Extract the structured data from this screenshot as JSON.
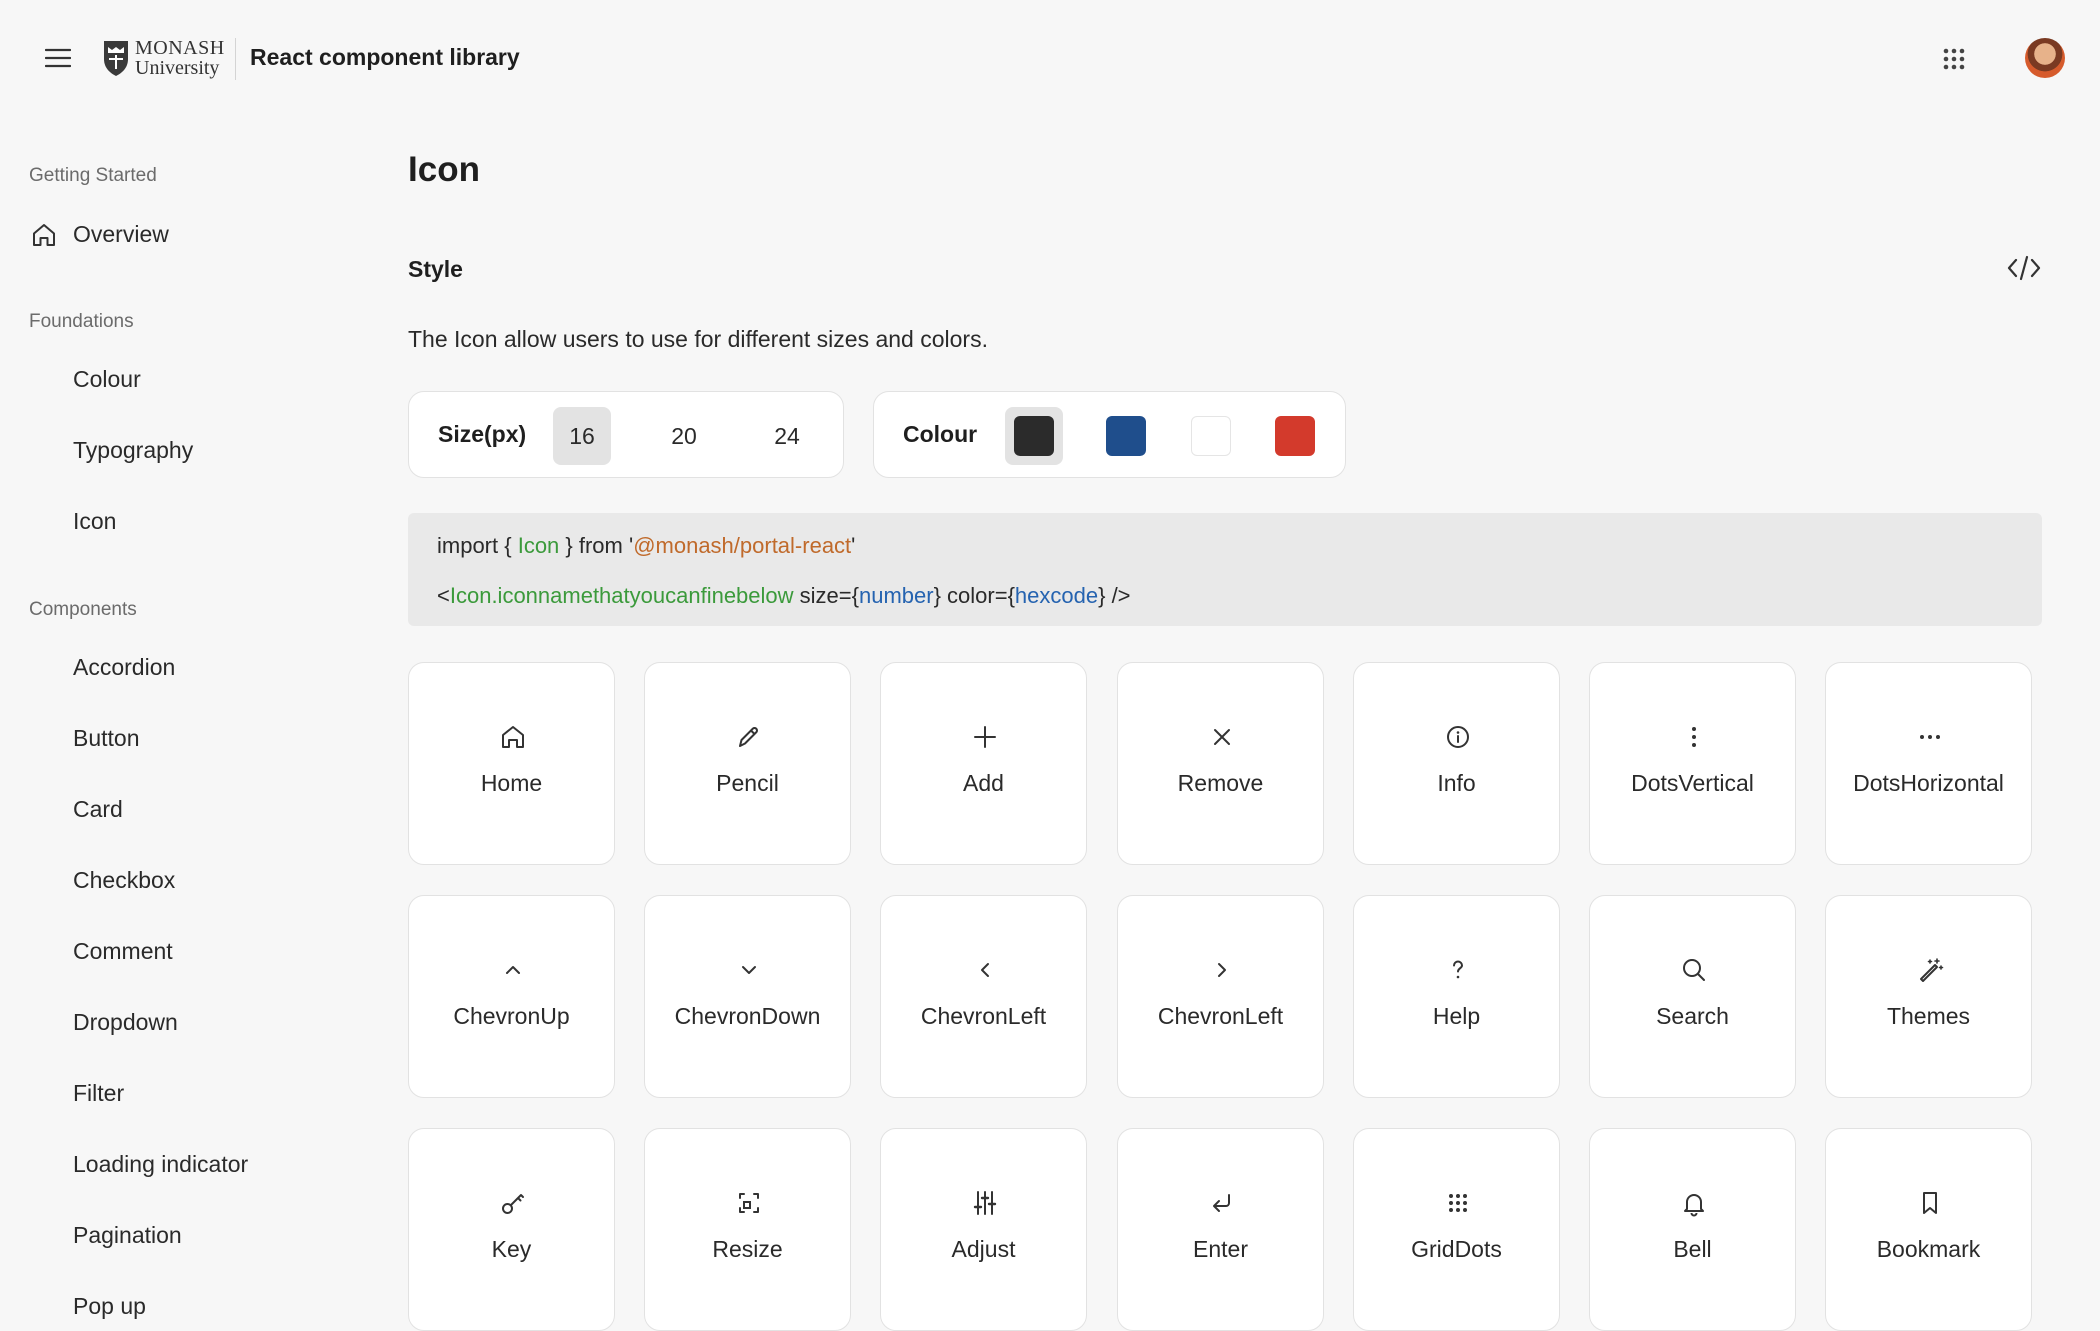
{
  "header": {
    "logo_line1": "MONASH",
    "logo_line2": "University",
    "app_title": "React component library",
    "icons": {
      "menu": "hamburger-icon",
      "apps": "grid-dots-icon"
    }
  },
  "sidebar": {
    "groups": {
      "getting_started": "Getting Started",
      "foundations": "Foundations",
      "components": "Components"
    },
    "getting_started_items": [
      "Overview"
    ],
    "foundation_items": [
      "Colour",
      "Typography",
      "Icon"
    ],
    "component_items": [
      "Accordion",
      "Button",
      "Card",
      "Checkbox",
      "Comment",
      "Dropdown",
      "Filter",
      "Loading indicator",
      "Pagination",
      "Pop up"
    ]
  },
  "main": {
    "title": "Icon",
    "section_title": "Style",
    "description": "The Icon allow users to use for different sizes and colors.",
    "size_label": "Size(px)",
    "sizes": [
      "16",
      "20",
      "24"
    ],
    "selected_size": "16",
    "colour_label": "Colour",
    "colours": [
      "#2b2b2b",
      "#1f4e8c",
      "#ffffff",
      "#d33a2c"
    ],
    "selected_colour": "#2b2b2b",
    "code": {
      "line1": {
        "a": "import { ",
        "b": "Icon",
        "c": " } from '",
        "d": "@monash/portal-react",
        "e": "'"
      },
      "line2": {
        "a": "<",
        "b": "Icon.iconnamethatyoucanfinebelow",
        "c": " size={",
        "d": "number",
        "e": "} color={",
        "f": "hexcode",
        "g": "} />"
      }
    },
    "icons": [
      {
        "label": "Home",
        "icon": "home-icon"
      },
      {
        "label": "Pencil",
        "icon": "pencil-icon"
      },
      {
        "label": "Add",
        "icon": "add-icon"
      },
      {
        "label": "Remove",
        "icon": "remove-icon"
      },
      {
        "label": "Info",
        "icon": "info-icon"
      },
      {
        "label": "DotsVertical",
        "icon": "dots-vertical-icon"
      },
      {
        "label": "DotsHorizontal",
        "icon": "dots-horizontal-icon"
      },
      {
        "label": "ChevronUp",
        "icon": "chevron-up-icon"
      },
      {
        "label": "ChevronDown",
        "icon": "chevron-down-icon"
      },
      {
        "label": "ChevronLeft",
        "icon": "chevron-left-icon"
      },
      {
        "label": "ChevronLeft",
        "icon": "chevron-right-icon"
      },
      {
        "label": "Help",
        "icon": "help-icon"
      },
      {
        "label": "Search",
        "icon": "search-icon"
      },
      {
        "label": "Themes",
        "icon": "themes-icon"
      },
      {
        "label": "Key",
        "icon": "key-icon"
      },
      {
        "label": "Resize",
        "icon": "resize-icon"
      },
      {
        "label": "Adjust",
        "icon": "adjust-icon"
      },
      {
        "label": "Enter",
        "icon": "enter-icon"
      },
      {
        "label": "GridDots",
        "icon": "grid-dots-icon"
      },
      {
        "label": "Bell",
        "icon": "bell-icon"
      },
      {
        "label": "Bookmark",
        "icon": "bookmark-icon"
      }
    ]
  }
}
